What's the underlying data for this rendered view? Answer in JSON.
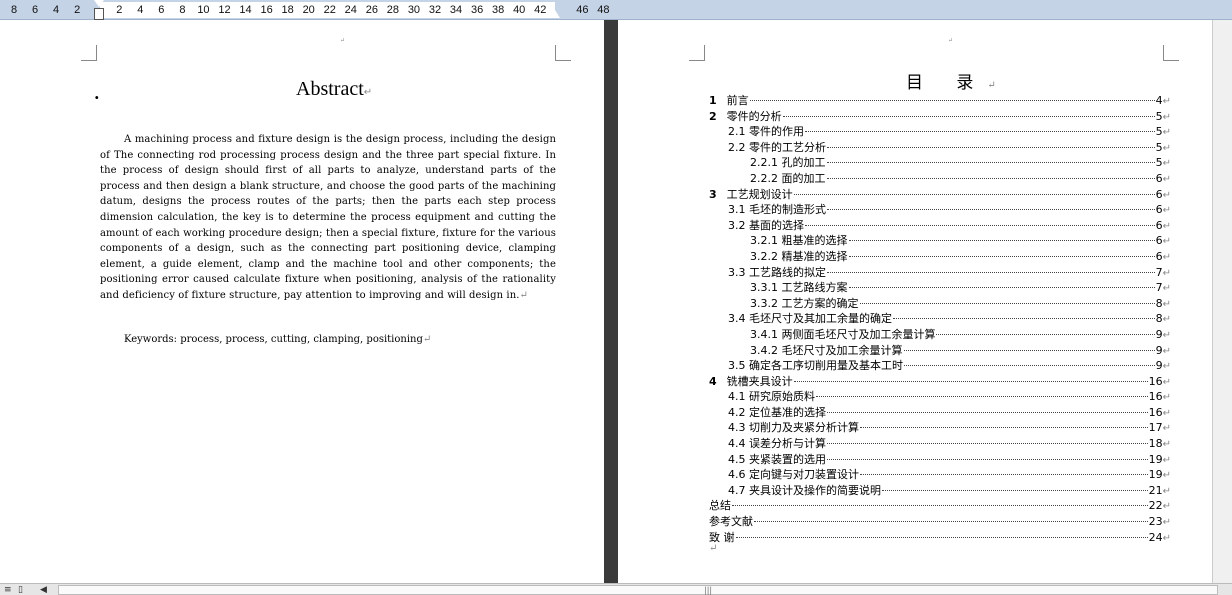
{
  "ruler": {
    "ticks": [
      "8",
      "6",
      "4",
      "2",
      "",
      "2",
      "4",
      "6",
      "8",
      "10",
      "12",
      "14",
      "16",
      "18",
      "20",
      "22",
      "24",
      "26",
      "28",
      "30",
      "32",
      "34",
      "36",
      "38",
      "40",
      "42",
      "",
      "46",
      "48"
    ]
  },
  "abstract": {
    "title": "Abstract",
    "body": "A machining process and fixture design is the design process, including the design of The connecting rod processing process design and the three part special fixture. In the process of design should first of all parts to analyze, understand parts of the process and then design a blank structure, and choose the good parts of the machining datum, designs the process routes of the parts; then the parts each step process dimension calculation, the key is to determine the process equipment and cutting the amount of each working procedure design; then a special fixture, fixture for the various components of a design, such as the connecting part positioning device, clamping element, a guide element, clamp and the machine tool and other components; the positioning error caused calculate fixture when positioning, analysis of the rationality and deficiency of fixture structure, pay attention to improving and will design in.",
    "keywords": "Keywords: process, process, cutting, clamping, positioning"
  },
  "toc": {
    "title": "目 录",
    "entries": [
      {
        "level": 1,
        "num": "1",
        "text": "前言",
        "page": "4"
      },
      {
        "level": 1,
        "num": "2",
        "text": "零件的分析",
        "page": "5"
      },
      {
        "level": 2,
        "num": "",
        "text": "2.1 零件的作用",
        "page": "5"
      },
      {
        "level": 2,
        "num": "",
        "text": "2.2 零件的工艺分析",
        "page": "5"
      },
      {
        "level": 3,
        "num": "",
        "text": "2.2.1 孔的加工",
        "page": "5"
      },
      {
        "level": 3,
        "num": "",
        "text": "2.2.2 面的加工",
        "page": "6"
      },
      {
        "level": 1,
        "num": "3",
        "text": "工艺规划设计",
        "page": "6"
      },
      {
        "level": 2,
        "num": "",
        "text": "3.1 毛坯的制造形式",
        "page": "6"
      },
      {
        "level": 2,
        "num": "",
        "text": "3.2 基面的选择",
        "page": "6"
      },
      {
        "level": 3,
        "num": "",
        "text": "3.2.1 粗基准的选择",
        "page": "6"
      },
      {
        "level": 3,
        "num": "",
        "text": "3.2.2 精基准的选择",
        "page": "6"
      },
      {
        "level": 2,
        "num": "",
        "text": "3.3 工艺路线的拟定",
        "page": "7"
      },
      {
        "level": 3,
        "num": "",
        "text": "3.3.1 工艺路线方案",
        "page": "7"
      },
      {
        "level": 3,
        "num": "",
        "text": "3.3.2 工艺方案的确定",
        "page": "8"
      },
      {
        "level": 2,
        "num": "",
        "text": "3.4 毛坯尺寸及其加工余量的确定",
        "page": "8"
      },
      {
        "level": 3,
        "num": "",
        "text": "3.4.1 两侧面毛坯尺寸及加工余量计算",
        "page": "9"
      },
      {
        "level": 3,
        "num": "",
        "text": "3.4.2 毛坯尺寸及加工余量计算",
        "page": "9"
      },
      {
        "level": 2,
        "num": "",
        "text": "3.5 确定各工序切削用量及基本工时",
        "page": "9"
      },
      {
        "level": 1,
        "num": "4",
        "text": "铣槽夹具设计",
        "page": "16"
      },
      {
        "level": 2,
        "num": "",
        "text": "4.1 研究原始质料",
        "page": "16"
      },
      {
        "level": 2,
        "num": "",
        "text": "4.2 定位基准的选择",
        "page": "16"
      },
      {
        "level": 2,
        "num": "",
        "text": "4.3  切削力及夹紧分析计算",
        "page": "17"
      },
      {
        "level": 2,
        "num": "",
        "text": "4.4  误差分析与计算",
        "page": "18"
      },
      {
        "level": 2,
        "num": "",
        "text": "4.5 夹紧装置的选用",
        "page": "19"
      },
      {
        "level": 2,
        "num": "",
        "text": "4.6  定向键与对刀装置设计",
        "page": "19"
      },
      {
        "level": 2,
        "num": "",
        "text": "4.7  夹具设计及操作的简要说明",
        "page": "21"
      },
      {
        "level": 1,
        "num": "",
        "text": "总结",
        "page": "22"
      },
      {
        "level": 1,
        "num": "",
        "text": "参考文献",
        "page": "23"
      },
      {
        "level": 1,
        "num": "",
        "text": "致  谢",
        "page": "24"
      }
    ]
  },
  "symbols": {
    "pilcrow": "↵"
  }
}
